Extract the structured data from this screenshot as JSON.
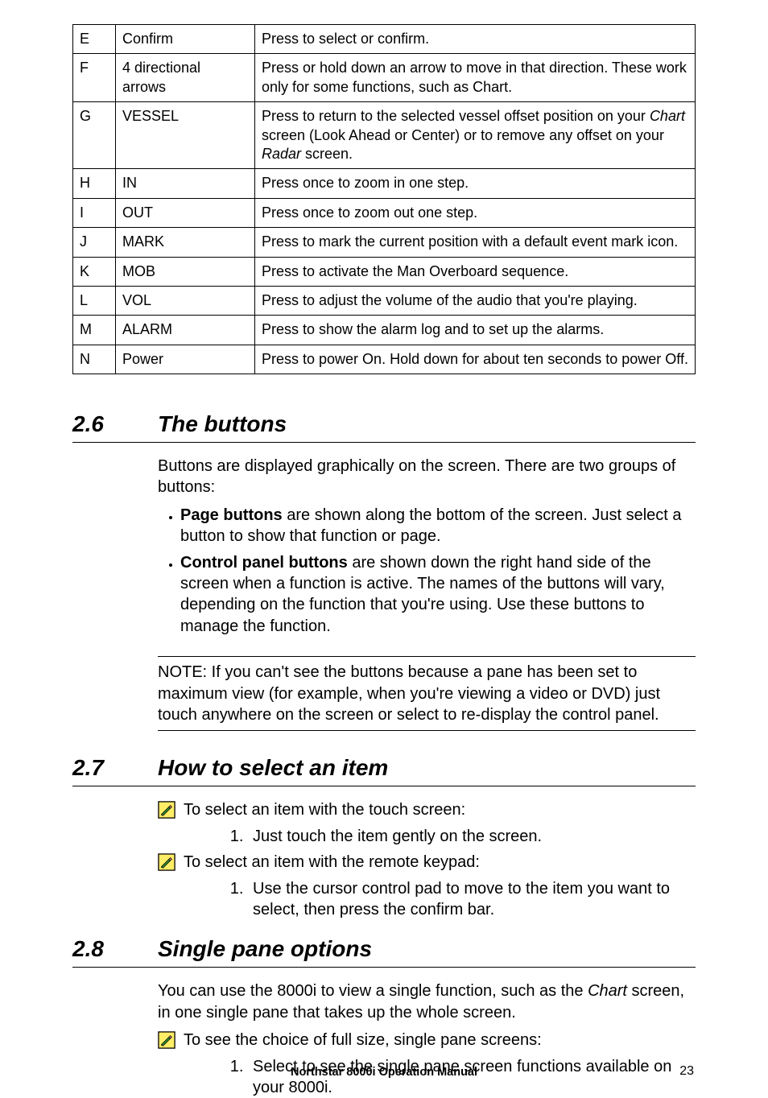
{
  "table": {
    "rows": [
      {
        "id": "E",
        "name": "Confirm",
        "desc": "Press to select or confirm."
      },
      {
        "id": "F",
        "name": "4 directional arrows",
        "desc": "Press or hold down an arrow to move in that direction. These work only for some functions, such as Chart."
      },
      {
        "id": "G",
        "name": "VESSEL",
        "desc_pre": "Press to return to the selected vessel offset position on your ",
        "desc_ital1": "Chart",
        "desc_mid": " screen (Look Ahead or Center) or to remove any offset on your ",
        "desc_ital2": "Radar",
        "desc_post": " screen."
      },
      {
        "id": "H",
        "name": "IN",
        "desc": "Press once to zoom in one step."
      },
      {
        "id": "I",
        "name": "OUT",
        "desc": "Press once to zoom out one step."
      },
      {
        "id": "J",
        "name": "MARK",
        "desc": "Press to mark the current position with a default event mark icon."
      },
      {
        "id": "K",
        "name": "MOB",
        "desc": "Press to activate the Man Overboard sequence."
      },
      {
        "id": "L",
        "name": "VOL",
        "desc": "Press to adjust the volume of the audio that you're playing."
      },
      {
        "id": "M",
        "name": "ALARM",
        "desc": "Press to show the alarm log and to set up the alarms."
      },
      {
        "id": "N",
        "name": "Power",
        "desc": "Press to power On. Hold down for about ten seconds to power Off."
      }
    ]
  },
  "sections": {
    "s26": {
      "num": "2.6",
      "title": "The buttons"
    },
    "s27": {
      "num": "2.7",
      "title": "How to select an item"
    },
    "s28": {
      "num": "2.8",
      "title": "Single pane options"
    }
  },
  "s26_body": {
    "intro": "Buttons are displayed graphically on the screen. There are two groups of buttons:",
    "bullet1_bold": "Page buttons",
    "bullet1_rest": " are shown along the bottom of the screen. Just select a button to show that function or page.",
    "bullet2_bold": "Control panel buttons",
    "bullet2_rest": " are shown down the right hand side of the screen when a function is active. The names of the buttons will vary, depending on the function that you're using. Use these buttons to manage the function.",
    "note": "NOTE: If you can't see the buttons because a pane has been set to maximum view (for example, when you're viewing a video or DVD) just touch anywhere on the screen or select                      to re-display the control panel."
  },
  "s27_body": {
    "pencil1": "To select an item with the touch screen:",
    "step1": "Just touch the item gently on the screen.",
    "pencil2": "To select an item with the remote keypad:",
    "step2": "Use the cursor control pad to move to the item you want to select, then press the confirm bar."
  },
  "s28_body": {
    "intro_pre": "You can use the 8000i to view a single function, such as the ",
    "intro_ital": "Chart",
    "intro_post": " screen, in one single pane that takes up the whole screen.",
    "pencil": "To see the choice of full size, single pane screens:",
    "step1": "Select                      to see the single pane screen functions available on your 8000i."
  },
  "footer": {
    "manual": "Northstar 8000i Operation Manual",
    "page": "23"
  }
}
